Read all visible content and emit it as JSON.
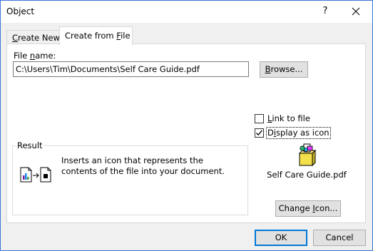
{
  "window": {
    "title": "Object",
    "help_label": "?",
    "close_icon": "close-icon"
  },
  "tabs": {
    "create_new": {
      "prefix": "",
      "accel": "C",
      "suffix": "reate New"
    },
    "create_from_file": {
      "prefix": "Create from ",
      "accel": "F",
      "suffix": "ile"
    },
    "active": "create_from_file"
  },
  "file": {
    "label_prefix": "File ",
    "label_accel": "n",
    "label_suffix": "ame:",
    "value": "C:\\Users\\Tim\\Documents\\Self Care Guide.pdf"
  },
  "browse": {
    "accel": "B",
    "suffix": "rowse..."
  },
  "options": {
    "link": {
      "prefix": "",
      "accel": "L",
      "suffix": "ink to file",
      "checked": false
    },
    "display": {
      "prefix": "D",
      "accel": "i",
      "suffix": "splay as icon",
      "checked": true
    }
  },
  "icon_preview": {
    "icon": "package-file-icon",
    "caption": "Self Care Guide.pdf"
  },
  "change_icon": {
    "prefix": "Change ",
    "accel": "I",
    "suffix": "con..."
  },
  "result": {
    "legend": "Result",
    "icon": "insert-as-icon-result-icon",
    "text": "Inserts an icon that represents the contents of the file into your document."
  },
  "buttons": {
    "ok": "OK",
    "cancel": "Cancel"
  },
  "colors": {
    "accent": "#0078d7",
    "window_border": "#3b78d8",
    "dialog_bg": "#f0f0f0"
  }
}
